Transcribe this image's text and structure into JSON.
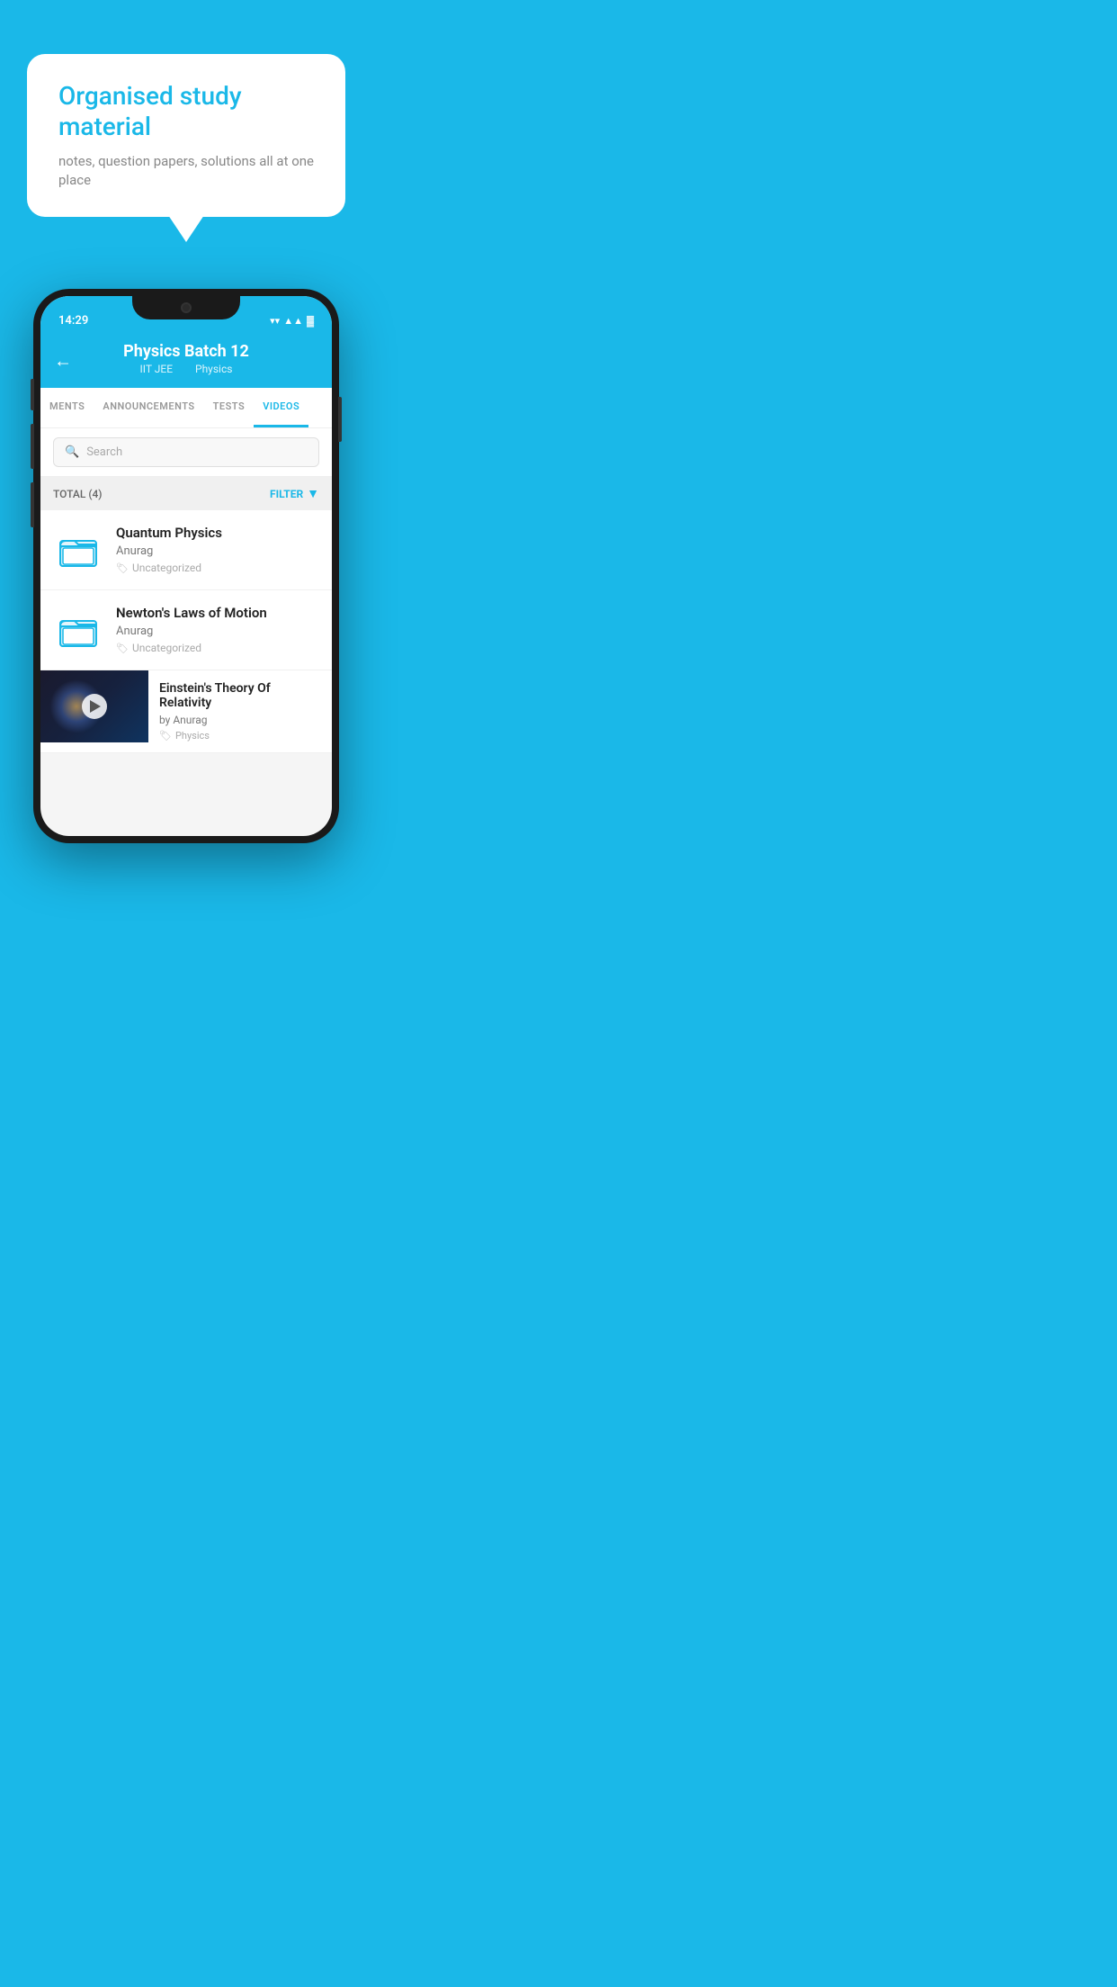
{
  "background_color": "#1ab8e8",
  "speech_bubble": {
    "title": "Organised study material",
    "subtitle": "notes, question papers, solutions all at one place"
  },
  "phone": {
    "status_bar": {
      "time": "14:29",
      "icons": [
        "wifi",
        "signal",
        "battery"
      ]
    },
    "header": {
      "title": "Physics Batch 12",
      "subtitle_parts": [
        "IIT JEE",
        "Physics"
      ],
      "back_label": "←"
    },
    "tabs": [
      {
        "label": "MENTS",
        "active": false
      },
      {
        "label": "ANNOUNCEMENTS",
        "active": false
      },
      {
        "label": "TESTS",
        "active": false
      },
      {
        "label": "VIDEOS",
        "active": true
      }
    ],
    "search": {
      "placeholder": "Search"
    },
    "filter_bar": {
      "total_label": "TOTAL (4)",
      "filter_label": "FILTER"
    },
    "video_items": [
      {
        "title": "Quantum Physics",
        "author": "Anurag",
        "tag": "Uncategorized",
        "type": "folder"
      },
      {
        "title": "Newton's Laws of Motion",
        "author": "Anurag",
        "tag": "Uncategorized",
        "type": "folder"
      },
      {
        "title": "Einstein's Theory Of Relativity",
        "author": "by Anurag",
        "tag": "Physics",
        "type": "video"
      }
    ]
  }
}
